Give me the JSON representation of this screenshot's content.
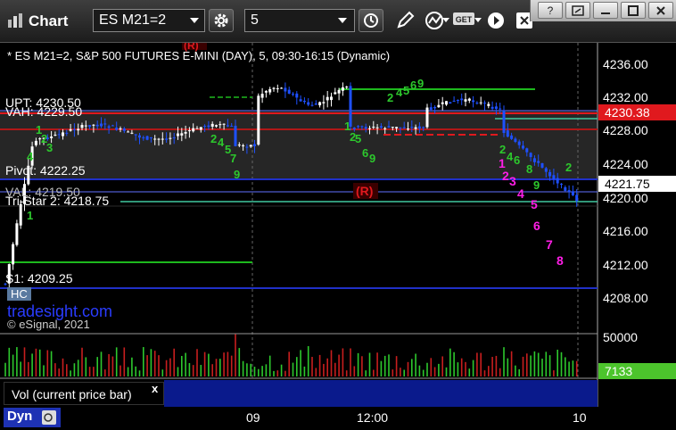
{
  "toolbar": {
    "app_title": "Chart",
    "symbol": "ES M21=2",
    "interval": "5"
  },
  "window": {
    "help_label": "?"
  },
  "chart": {
    "info_line": "* ES M21=2, S&P 500 FUTURES E-MINI (DAY), 5, 09:30-16:15 (Dynamic)",
    "level_labels": {
      "upt": "UPT: 4230.50",
      "vah": "VAH: 4229.50",
      "pivot": "Pivot: 4222.25",
      "val": "VAL: 4219.50",
      "tristar": "Tri-Star 2: 4218.75",
      "s1": "S1: 4209.25",
      "hc": "HC"
    },
    "price_axis": [
      "4236.00",
      "4232.00",
      "4228.00",
      "4224.00",
      "4220.00",
      "4216.00",
      "4212.00",
      "4208.00"
    ],
    "price_badges": {
      "red": "4230.38",
      "last": "4221.75"
    },
    "markers": {
      "r_top": "(R)",
      "r_mid": "(R)",
      "magenta_counts": [
        "1",
        "2",
        "3",
        "4",
        "5",
        "6",
        "7",
        "8"
      ]
    },
    "watermark": "tradesight.com",
    "copyright": "© eSignal, 2021",
    "colors": {
      "up_candle": "#ffffff",
      "down_candle": "#1e50ff",
      "level_red": "#e0191e",
      "level_green": "#1db91d",
      "level_blue": "#2030c8",
      "level_teal": "#40c8a0",
      "magenta": "#ff1ee6",
      "vol_badge": "#4cc42c"
    }
  },
  "volume": {
    "axis_top": "50000",
    "last_vol": "7133",
    "label": "Vol (current price bar)",
    "close": "x"
  },
  "time_axis": {
    "labels": [
      "09",
      "12:00",
      "10"
    ]
  },
  "bottom": {
    "dyn_label": "Dyn"
  }
}
